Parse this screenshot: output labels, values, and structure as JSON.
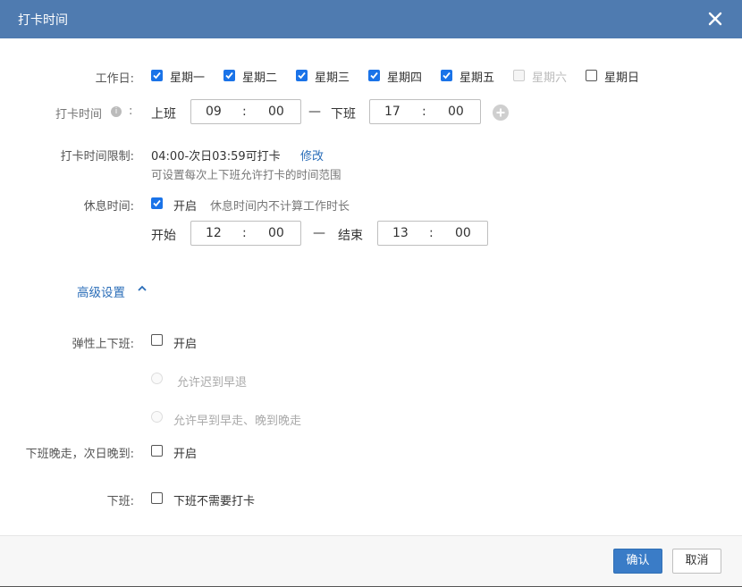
{
  "dialog": {
    "title": "打卡时间",
    "close_icon": "close-icon"
  },
  "workdays": {
    "label": "工作日:",
    "days": [
      {
        "label": "星期一",
        "checked": true,
        "disabled": false
      },
      {
        "label": "星期二",
        "checked": true,
        "disabled": false
      },
      {
        "label": "星期三",
        "checked": true,
        "disabled": false
      },
      {
        "label": "星期四",
        "checked": true,
        "disabled": false
      },
      {
        "label": "星期五",
        "checked": true,
        "disabled": false
      },
      {
        "label": "星期六",
        "checked": false,
        "disabled": true
      },
      {
        "label": "星期日",
        "checked": false,
        "disabled": false
      }
    ]
  },
  "punch_time": {
    "label": "打卡时间",
    "info_icon": "i",
    "colon": ":",
    "on_label": "上班",
    "on_hour": "09",
    "on_min": "00",
    "dash": "—",
    "off_label": "下班",
    "off_hour": "17",
    "off_min": "00",
    "sep": ":"
  },
  "limit": {
    "label": "打卡时间限制:",
    "value": "04:00-次日03:59可打卡",
    "edit": "修改",
    "hint": "可设置每次上下班允许打卡的时间范围"
  },
  "rest": {
    "label": "休息时间:",
    "enable": "开启",
    "enabled": true,
    "desc": "休息时间内不计算工作时长",
    "start_label": "开始",
    "start_hour": "12",
    "start_min": "00",
    "dash": "—",
    "end_label": "结束",
    "end_hour": "13",
    "end_min": "00",
    "sep": ":"
  },
  "advanced": {
    "label": "高级设置"
  },
  "flexible": {
    "label": "弹性上下班:",
    "enable": "开启",
    "opt1": "允许迟到早退",
    "opt2": "允许早到早走、晚到晚走"
  },
  "late_leave": {
    "label": "下班晚走，次日晚到:",
    "enable": "开启"
  },
  "off_duty": {
    "label": "下班:",
    "option": "下班不需要打卡"
  },
  "footer": {
    "confirm": "确认",
    "cancel": "取消"
  },
  "colors": {
    "titlebar": "#4f7bb0",
    "checkbox": "#1a73e8",
    "primary_button": "#3a7cc7",
    "link": "#2a6db8"
  }
}
